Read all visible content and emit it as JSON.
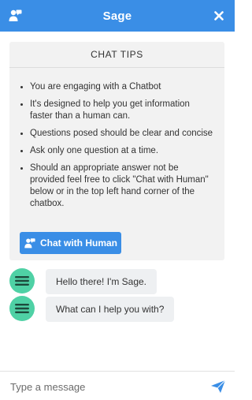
{
  "header": {
    "title": "Sage",
    "human_icon": "person-chat-icon",
    "close_icon": "close-icon"
  },
  "tips": {
    "title": "CHAT TIPS",
    "items": [
      "You are engaging with a Chatbot",
      "It's designed to help you get information faster than a human can.",
      "Questions posed should be clear and concise",
      "Ask only one question at a time.",
      "Should an appropriate answer not be provided feel free to click \"Chat with Human\" below or in the top left hand corner of the chatbox."
    ],
    "human_button_label": "Chat with Human"
  },
  "messages": [
    {
      "sender": "bot",
      "text": "Hello there! I'm Sage."
    },
    {
      "sender": "bot",
      "text": "What can I help you with?"
    }
  ],
  "composer": {
    "placeholder": "Type a message",
    "send_icon": "send-icon"
  },
  "colors": {
    "accent": "#3a8ee6",
    "avatar": "#4fd1a5",
    "card_bg": "#f2f2f2",
    "bubble_bg": "#eef0f2"
  }
}
